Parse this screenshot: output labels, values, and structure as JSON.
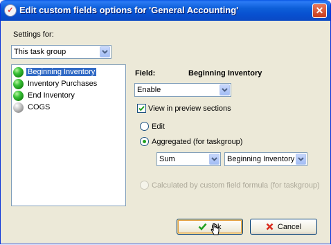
{
  "window": {
    "title": "Edit custom fields options for  'General Accounting'",
    "close_label": "✕"
  },
  "settings": {
    "label": "Settings for:",
    "selected": "This task group"
  },
  "fields_list": {
    "items": [
      {
        "label": "Beginning Inventory",
        "status": "green",
        "selected": true
      },
      {
        "label": "Inventory Purchases",
        "status": "green",
        "selected": false
      },
      {
        "label": "End Inventory",
        "status": "green",
        "selected": false
      },
      {
        "label": "COGS",
        "status": "gray",
        "selected": false
      }
    ]
  },
  "field_panel": {
    "field_label": "Field:",
    "field_name": "Beginning Inventory",
    "enable_selected": "Enable",
    "view_in_preview_label": "View in preview sections",
    "view_in_preview_checked": true,
    "options": {
      "edit_label": "Edit",
      "aggregated_label": "Aggregated (for taskgroup)",
      "calculated_label": "Calculated by custom field formula (for taskgroup)",
      "selected": "aggregated"
    },
    "aggregate_function": "Sum",
    "aggregate_field": "Beginning Inventory"
  },
  "buttons": {
    "ok_label": "Ok",
    "cancel_label": "Cancel"
  },
  "colors": {
    "titlebar": "#0a58e4",
    "selection": "#316ac5",
    "radio_fill": "#21a121"
  }
}
